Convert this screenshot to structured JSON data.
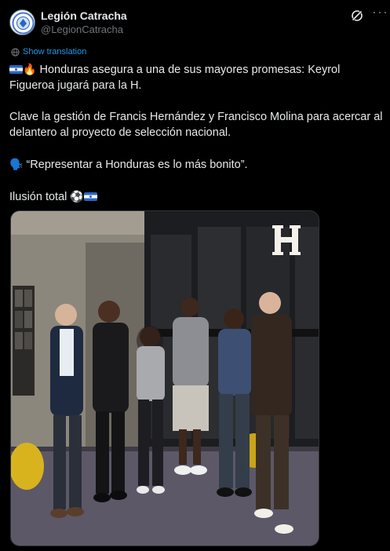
{
  "author": {
    "name": "Legión Catracha",
    "handle": "@LegionCatracha",
    "avatar_icon": "legion-catracha-logo"
  },
  "actions": {
    "grok_icon": "grok-icon",
    "more_label": "···"
  },
  "translate": {
    "label": "Show translation"
  },
  "tweet": {
    "line1": "Honduras asegura a una de sus mayores promesas: Keyrol Figueroa jugará para la H.",
    "line2": "Clave la gestión de Francis Hernández y Francisco Molina para acercar al delantero al proyecto de selección nacional.",
    "line3": "“Representar a Honduras es lo más bonito”.",
    "line4": "Ilusión total",
    "fire_emoji": "🔥",
    "speaker_emoji": "🗣️",
    "ball_emoji": "⚽"
  },
  "media": {
    "watermark": "H"
  },
  "colors": {
    "background": "#000000",
    "text": "#e7e9ea",
    "muted": "#71767b",
    "link": "#1d9bf0"
  }
}
